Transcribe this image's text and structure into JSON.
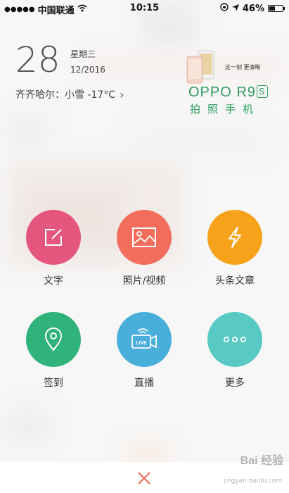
{
  "status_bar": {
    "carrier": "中国联通",
    "time": "10:15",
    "battery_percent_text": "46%",
    "battery_level": 0.46
  },
  "widget": {
    "day": "28",
    "weekday": "星期三",
    "month_year": "12/2016",
    "weather": "齐齐哈尔：小雪 -17°C"
  },
  "ad": {
    "tagline": "这一刻  更清晰",
    "brand": "OPPO R9",
    "brand_suffix": "S",
    "slogan": "拍照手机",
    "color": "#2e9e5e"
  },
  "actions": [
    {
      "label": "文字",
      "icon": "edit-icon",
      "color": "#e5567e"
    },
    {
      "label": "照片/视频",
      "icon": "image-icon",
      "color": "#f26d5b"
    },
    {
      "label": "头条文章",
      "icon": "lightning-icon",
      "color": "#f7a21b"
    },
    {
      "label": "签到",
      "icon": "location-pin-icon",
      "color": "#2fb37a"
    },
    {
      "label": "直播",
      "icon": "live-camera-icon",
      "color": "#4aaedb"
    },
    {
      "label": "更多",
      "icon": "more-dots-icon",
      "color": "#59c9c4"
    }
  ],
  "bottom_bar": {
    "close_icon": "close-icon",
    "close_color": "#f26d5b"
  },
  "watermark": {
    "text": "Bai 经验",
    "sub": "jingyan.baidu.com"
  }
}
